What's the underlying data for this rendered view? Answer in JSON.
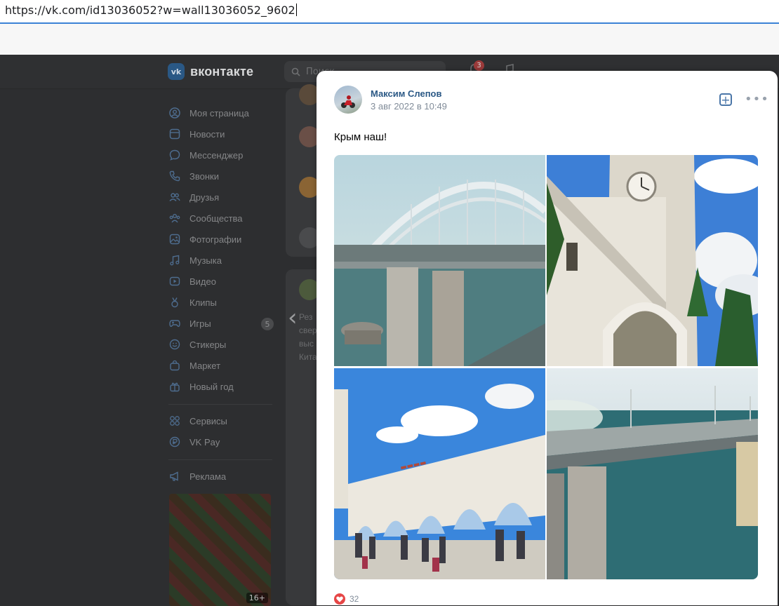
{
  "browser": {
    "url": "https://vk.com/id13036052?w=wall13036052_9602"
  },
  "header": {
    "logo_text": "вконтакте",
    "logo_mark": "vk",
    "search_placeholder": "Поиск",
    "notifications_count": "3"
  },
  "sidebar": {
    "items": [
      {
        "label": "Моя страница",
        "icon": "user-circle-icon"
      },
      {
        "label": "Новости",
        "icon": "newspaper-icon"
      },
      {
        "label": "Мессенджер",
        "icon": "chat-bubble-icon"
      },
      {
        "label": "Звонки",
        "icon": "phone-icon"
      },
      {
        "label": "Друзья",
        "icon": "friends-icon"
      },
      {
        "label": "Сообщества",
        "icon": "communities-icon"
      },
      {
        "label": "Фотографии",
        "icon": "photo-icon"
      },
      {
        "label": "Музыка",
        "icon": "music-icon"
      },
      {
        "label": "Видео",
        "icon": "video-icon"
      },
      {
        "label": "Клипы",
        "icon": "clips-icon"
      },
      {
        "label": "Игры",
        "icon": "gamepad-icon",
        "badge": "5"
      },
      {
        "label": "Стикеры",
        "icon": "sticker-icon"
      },
      {
        "label": "Маркет",
        "icon": "shopping-bag-icon"
      },
      {
        "label": "Новый год",
        "icon": "gift-icon"
      }
    ],
    "items_secondary": [
      {
        "label": "Сервисы",
        "icon": "services-grid-icon"
      },
      {
        "label": "VK Pay",
        "icon": "vk-pay-icon"
      }
    ],
    "items_tertiary": [
      {
        "label": "Реклама",
        "icon": "megaphone-icon"
      }
    ],
    "game_ad_age": "16+"
  },
  "feed": {
    "partial_text": [
      "Рез",
      "свер",
      "выс",
      "Кита"
    ]
  },
  "post": {
    "author": "Максим Слепов",
    "date": "3 авг 2022 в 10:49",
    "text": "Крым наш!",
    "photos": [
      {
        "subject": "bridge-arch-photo"
      },
      {
        "subject": "clock-tower-photo"
      },
      {
        "subject": "station-colonnade-photo"
      },
      {
        "subject": "bridge-sea-photo"
      }
    ],
    "likes": "32"
  },
  "colors": {
    "link": "#2a5885",
    "accent": "#4a76a8",
    "like": "#e64646",
    "overlay_bg": "#2d2e30"
  }
}
